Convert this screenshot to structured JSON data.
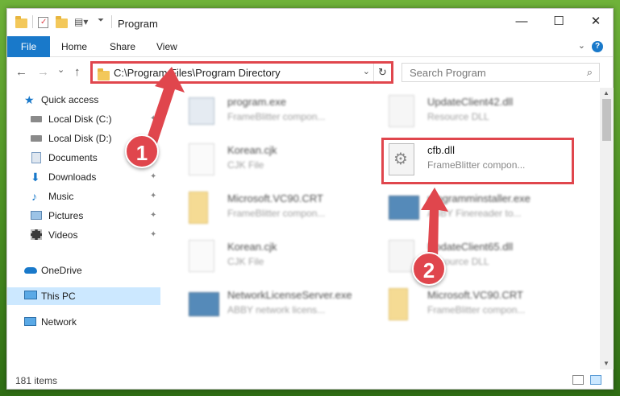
{
  "window": {
    "title": "Program",
    "controls": {
      "minimize": "—",
      "maximize": "☐",
      "close": "✕"
    }
  },
  "ribbon": {
    "tabs": [
      "File",
      "Home",
      "Share",
      "View"
    ],
    "help": "?"
  },
  "nav": {
    "back": "←",
    "forward": "→",
    "recent": "⌄",
    "up": "↑",
    "address": "C:\\Program Files\\Program Directory",
    "refresh": "↻",
    "search_placeholder": "Search Program",
    "search_icon": "⌕"
  },
  "sidebar": {
    "items": [
      {
        "label": "Quick access",
        "icon": "star-icon",
        "color": "#1979ca"
      },
      {
        "label": "Local Disk (C:)",
        "icon": "drive-icon",
        "pinned": true
      },
      {
        "label": "Local Disk (D:)",
        "icon": "drive-icon",
        "pinned": true
      },
      {
        "label": "Documents",
        "icon": "documents-icon",
        "pinned": true
      },
      {
        "label": "Downloads",
        "icon": "downloads-icon",
        "pinned": true
      },
      {
        "label": "Music",
        "icon": "music-icon",
        "pinned": true
      },
      {
        "label": "Pictures",
        "icon": "pictures-icon",
        "pinned": true
      },
      {
        "label": "Videos",
        "icon": "videos-icon",
        "pinned": true
      },
      {
        "label": "OneDrive",
        "icon": "onedrive-icon"
      },
      {
        "label": "This PC",
        "icon": "pc-icon",
        "selected": true
      },
      {
        "label": "Network",
        "icon": "network-icon"
      }
    ],
    "pin_glyph": "📌"
  },
  "files": [
    {
      "name": "program.exe",
      "desc": "FrameBlitter compon...",
      "icon": "exe-icon",
      "blurred": true
    },
    {
      "name": "UpdateClient42.dll",
      "desc": "Resource DLL",
      "icon": "dll-icon",
      "blurred": true
    },
    {
      "name": "Korean.cjk",
      "desc": "CJK File",
      "icon": "file-icon",
      "blurred": true
    },
    {
      "name": "cfb.dll",
      "desc": "FrameBlitter compon...",
      "icon": "dll-gear-icon",
      "blurred": false
    },
    {
      "name": "Microsoft.VC90.CRT",
      "desc": "FrameBlitter compon...",
      "icon": "folder-icon",
      "blurred": true
    },
    {
      "name": "programminstaller.exe",
      "desc": "ABBY Finereader to...",
      "icon": "exe-icon",
      "blurred": true
    },
    {
      "name": "Korean.cjk",
      "desc": "CJK File",
      "icon": "file-icon",
      "blurred": true
    },
    {
      "name": "UpdateClient65.dll",
      "desc": "Resource DLL",
      "icon": "dll-icon",
      "blurred": true
    },
    {
      "name": "NetworkLicenseServer.exe",
      "desc": "ABBY network licens...",
      "icon": "exe-icon",
      "blurred": true
    },
    {
      "name": "Microsoft.VC90.CRT",
      "desc": "FrameBlitter compon...",
      "icon": "folder-icon",
      "blurred": true
    }
  ],
  "status": {
    "items": "181 items"
  },
  "annotations": {
    "step1": "1",
    "step2": "2",
    "accent": "#e0464d"
  }
}
